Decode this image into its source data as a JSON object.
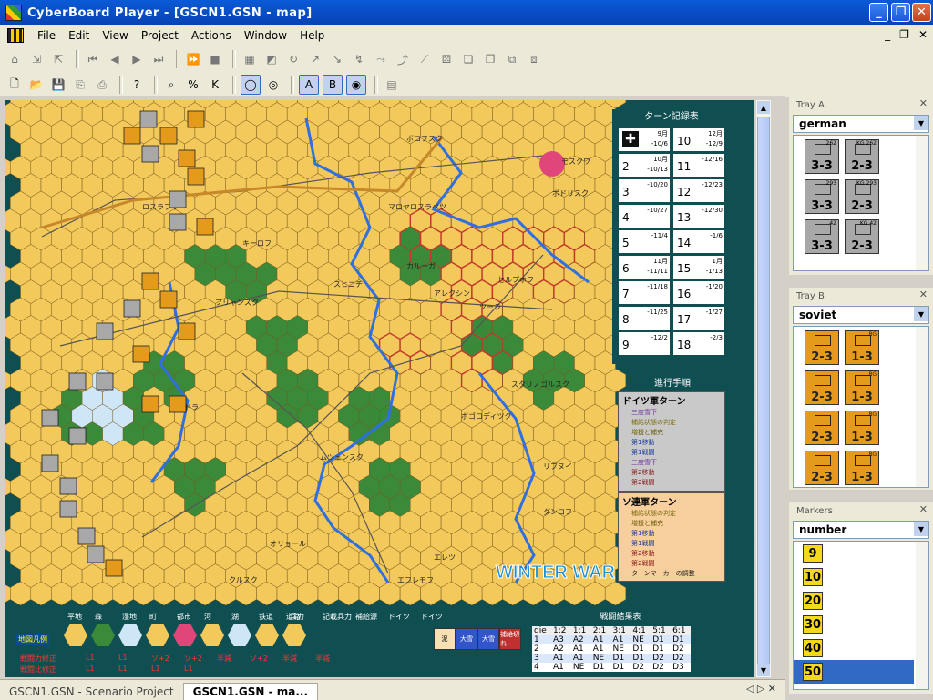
{
  "window": {
    "title": "CyberBoard Player - [GSCN1.GSN - map]",
    "min": "_",
    "max": "❐",
    "close": "✕"
  },
  "menu": [
    "File",
    "Edit",
    "View",
    "Project",
    "Actions",
    "Window",
    "Help"
  ],
  "mdi_controls": [
    "_",
    "❐",
    "✕"
  ],
  "map": {
    "turn_record_title": "ターン記録表",
    "turn_record": [
      {
        "n": "",
        "date": "9月\n-10/6"
      },
      {
        "n": "10",
        "date": "12月\n-12/9"
      },
      {
        "n": "2",
        "date": "10月\n-10/13"
      },
      {
        "n": "11",
        "date": "-12/16"
      },
      {
        "n": "3",
        "date": "-10/20"
      },
      {
        "n": "12",
        "date": "-12/23"
      },
      {
        "n": "4",
        "date": "-10/27"
      },
      {
        "n": "13",
        "date": "-12/30"
      },
      {
        "n": "5",
        "date": "-11/4"
      },
      {
        "n": "14",
        "date": "-1/6"
      },
      {
        "n": "6",
        "date": "11月\n-11/11"
      },
      {
        "n": "15",
        "date": "1月\n-1/13"
      },
      {
        "n": "7",
        "date": "-11/18"
      },
      {
        "n": "16",
        "date": "-1/20"
      },
      {
        "n": "8",
        "date": "-11/25"
      },
      {
        "n": "17",
        "date": "-1/27"
      },
      {
        "n": "9",
        "date": "-12/2"
      },
      {
        "n": "18",
        "date": "-2/3"
      }
    ],
    "sequence_title": "進行手順",
    "german_turn_title": "ドイツ軍ターン",
    "german_steps": [
      "三度雪下",
      "補給状態の判定",
      "増援と補充",
      "第1移動",
      "第1戦闘",
      "三度雪下",
      "第2移動",
      "第2戦闘"
    ],
    "soviet_turn_title": "ソ連軍ターン",
    "soviet_steps": [
      "補給状態の判定",
      "増援と補充",
      "第1移動",
      "第1戦闘",
      "第2移動",
      "第2戦闘",
      "ターンマーカーの調整"
    ],
    "winter_war": "WINTER WAR",
    "legend_title": "地図凡例",
    "legend_terrain": [
      "平地",
      "森",
      "湿地",
      "町",
      "都市",
      "河",
      "湖",
      "鉄道",
      "道路"
    ],
    "legend_extra": [
      "兵力",
      "記載兵力",
      "補給源",
      "ドイツ",
      "ドイツ"
    ],
    "legend_row1": [
      "戦闘力修正",
      "L1",
      "L1",
      "ソ+2",
      "ソ+2",
      "半減",
      "ソ+2",
      "半減",
      "半減"
    ],
    "legend_row2": [
      "戦闘比修正",
      "L1",
      "L1",
      "L1",
      "L1"
    ],
    "crt_title": "戦闘結果表",
    "crt_header": [
      "die",
      "1:2",
      "1:1",
      "2:1",
      "3:1",
      "4:1",
      "5:1",
      "6:1"
    ],
    "crt_rows": [
      [
        "1",
        "A3",
        "A2",
        "A1",
        "A1",
        "NE",
        "D1",
        "D1"
      ],
      [
        "2",
        "A2",
        "A1",
        "A1",
        "NE",
        "D1",
        "D1",
        "D2"
      ],
      [
        "3",
        "A1",
        "A1",
        "NE",
        "D1",
        "D1",
        "D2",
        "D2"
      ],
      [
        "4",
        "A1",
        "NE",
        "D1",
        "D1",
        "D2",
        "D2",
        "D3"
      ]
    ],
    "extra_boxes": [
      "泥",
      "大雪",
      "大雪",
      "補給切れ"
    ],
    "town_labels": [
      "ボロフスク",
      "マロヤロスラベツ",
      "カルーガ",
      "アレクシン",
      "ツーラ",
      "スヒニチ",
      "ブリャンスク",
      "オリョール",
      "ムツェンスク",
      "エフレモフ",
      "エレツ",
      "リブヌイ",
      "ジズドラ",
      "ロスラブリ",
      "キーロフ",
      "モスクワ",
      "ポドリスク",
      "セルプホフ",
      "スタリノゴルスク",
      "ボゴロディツク",
      "ダンコフ",
      "クルスク"
    ]
  },
  "trays": {
    "a": {
      "title": "Tray A",
      "selection": "german",
      "units": [
        {
          "label": "3-3",
          "top": "262"
        },
        {
          "label": "2-3",
          "top": "KG 262"
        },
        {
          "label": "3-3",
          "top": "293"
        },
        {
          "label": "2-3",
          "top": "KG 293"
        },
        {
          "label": "3-3",
          "top": "42"
        },
        {
          "label": "2-3",
          "top": "KG 42"
        }
      ]
    },
    "b": {
      "title": "Tray B",
      "selection": "soviet",
      "units": [
        {
          "label": "2-3",
          "top": ""
        },
        {
          "label": "1-3",
          "top": "BG"
        },
        {
          "label": "2-3",
          "top": ""
        },
        {
          "label": "1-3",
          "top": "BG"
        },
        {
          "label": "2-3",
          "top": ""
        },
        {
          "label": "1-3",
          "top": "BG"
        },
        {
          "label": "2-3",
          "top": ""
        },
        {
          "label": "1-3",
          "top": "BG"
        }
      ]
    },
    "markers": {
      "title": "Markers",
      "selection": "number",
      "items": [
        "9",
        "10",
        "20",
        "30",
        "40",
        "50"
      ]
    }
  },
  "tabs": [
    "GSCN1.GSN - Scenario Project",
    "GSCN1.GSN - ma..."
  ],
  "tab_nav": "◁ ▷ ✕",
  "colors": {
    "title_bar": "#0a5ad6",
    "map_bg": "#0f4f52",
    "clear_terrain": "#f2c95a",
    "forest": "#3a8a3a",
    "river": "#2f6fe0",
    "soviet_unit": "#e49a1a",
    "german_unit": "#a8a8a8",
    "marker": "#f4d81a"
  }
}
